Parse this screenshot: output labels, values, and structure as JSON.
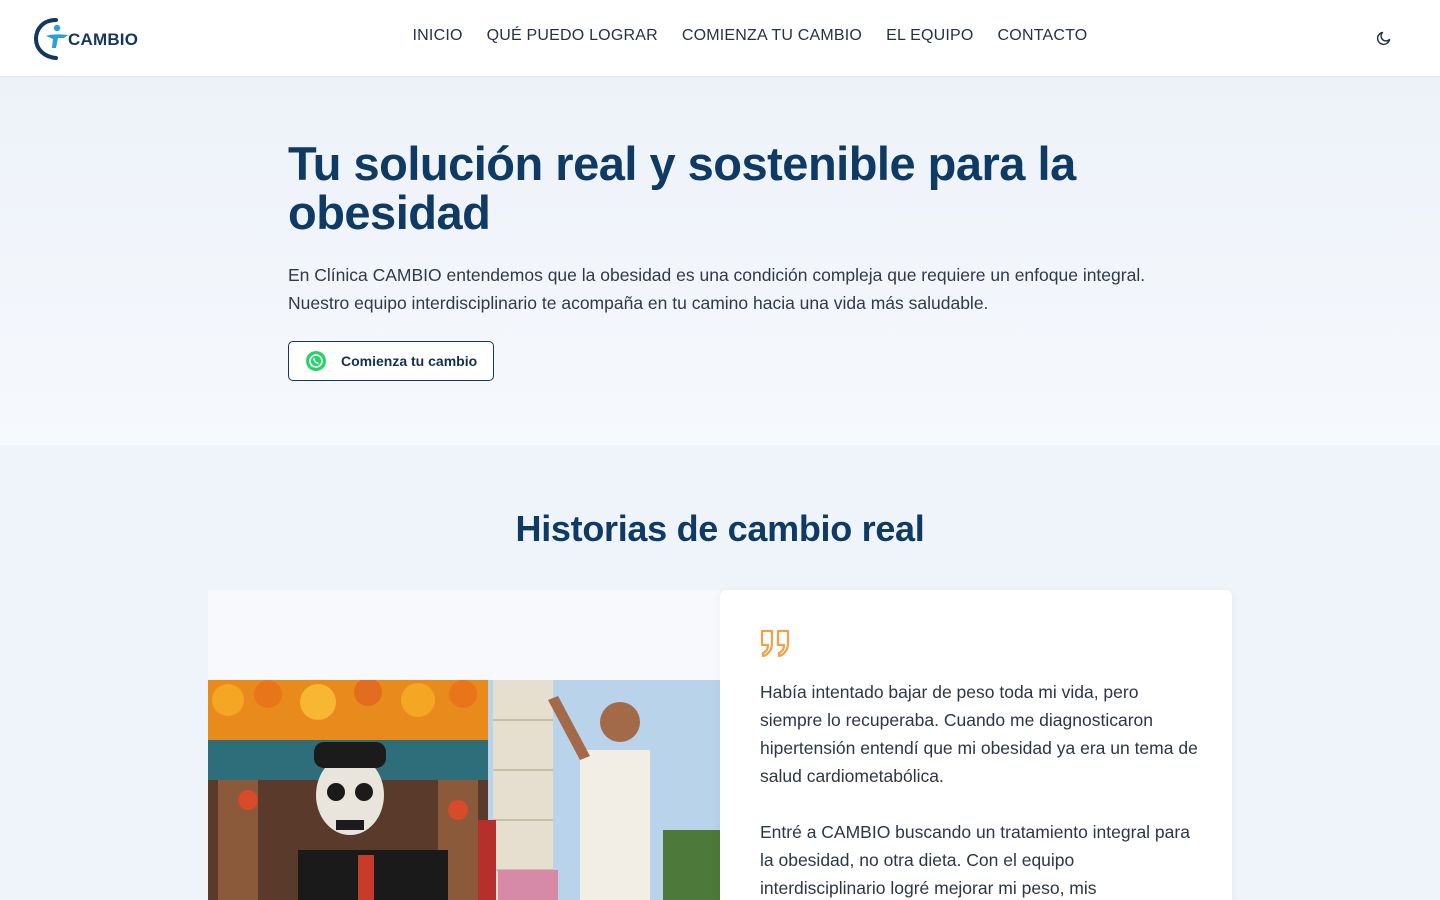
{
  "header": {
    "logo_text": "CAMBIO",
    "nav": [
      "INICIO",
      "QUÉ PUEDO LOGRAR",
      "COMIENZA TU CAMBIO",
      "EL EQUIPO",
      "CONTACTO"
    ],
    "theme_icon": "moon-icon"
  },
  "hero": {
    "title": "Tu solución real y sostenible para la obesidad",
    "text": "En Clínica CAMBIO entendemos que la obesidad es una condición compleja que requiere un enfoque integral. Nuestro equipo interdisciplinario te acompaña en tu camino hacia una vida más saludable.",
    "cta_label": "Comienza tu cambio",
    "cta_icon": "whatsapp-icon"
  },
  "stories": {
    "title": "Historias de cambio real",
    "quote_icon": "quote-icon",
    "paragraphs": [
      "Había intentado bajar de peso toda mi vida, pero siempre lo recuperaba. Cuando me diagnosticaron hipertensión entendí que mi obesidad ya era un tema de salud cardiometabólica.",
      "Entré a CAMBIO buscando un tratamiento integral para la obesidad, no otra dieta. Con el equipo interdisciplinario logré mejorar mi peso, mis"
    ]
  },
  "colors": {
    "brand_navy": "#0e3a63",
    "accent_orange": "#f0a24a",
    "whatsapp_green": "#25d366"
  }
}
